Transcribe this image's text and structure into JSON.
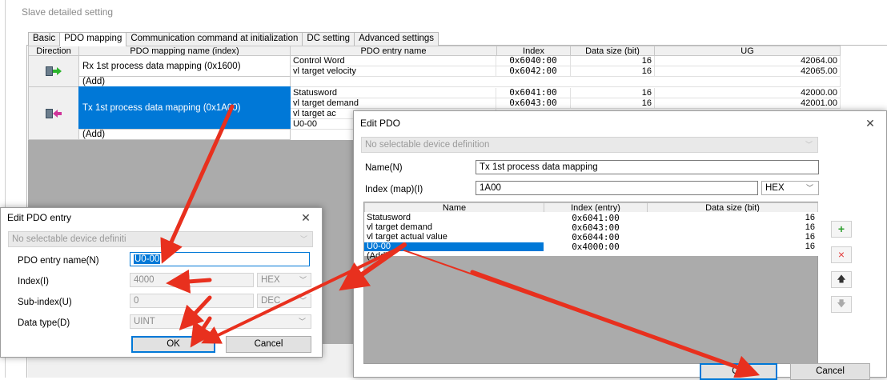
{
  "window": {
    "title": "Slave detailed setting"
  },
  "tabs": [
    "Basic",
    "PDO mapping",
    "Communication command at initialization",
    "DC setting",
    "Advanced settings"
  ],
  "grid": {
    "headers": [
      "Direction",
      "PDO mapping name (index)",
      "PDO entry name",
      "Index",
      "Data size (bit)",
      "UG"
    ],
    "rx": {
      "name": "Rx 1st process data mapping (0x1600)",
      "entries": [
        {
          "name": "Control Word",
          "index": "0x6040:00",
          "size": "16",
          "ug": "42064.00"
        },
        {
          "name": "vl target velocity",
          "index": "0x6042:00",
          "size": "16",
          "ug": "42065.00"
        }
      ],
      "add": "(Add)"
    },
    "tx": {
      "name": "Tx 1st process data mapping (0x1A00)",
      "entries": [
        {
          "name": "Statusword",
          "index": "0x6041:00",
          "size": "16",
          "ug": "42000.00"
        },
        {
          "name": "vl target demand",
          "index": "0x6043:00",
          "size": "16",
          "ug": "42001.00"
        },
        {
          "name": "vl target ac",
          "index": "",
          "size": "",
          "ug": ""
        },
        {
          "name": "U0-00",
          "index": "",
          "size": "",
          "ug": ""
        }
      ],
      "add": "(Add)"
    }
  },
  "edit_pdo_entry": {
    "title": "Edit PDO entry",
    "device_def": "No selectable device definiti",
    "labels": {
      "name": "PDO entry name(N)",
      "index": "Index(I)",
      "subindex": "Sub-index(U)",
      "dtype": "Data type(D)"
    },
    "values": {
      "name": "U0-00",
      "index": "4000",
      "index_fmt": "HEX",
      "subindex": "0",
      "subindex_fmt": "DEC",
      "dtype": "UINT"
    },
    "ok": "OK",
    "cancel": "Cancel"
  },
  "edit_pdo": {
    "title": "Edit PDO",
    "device_def": "No selectable device definition",
    "labels": {
      "name": "Name(N)",
      "index": "Index (map)(I)"
    },
    "values": {
      "name": "Tx 1st process data mapping",
      "index": "1A00",
      "index_fmt": "HEX"
    },
    "headers": [
      "Name",
      "Index (entry)",
      "Data size (bit)"
    ],
    "entries": [
      {
        "name": "Statusword",
        "index": "0x6041:00",
        "size": "16"
      },
      {
        "name": "vl target demand",
        "index": "0x6043:00",
        "size": "16"
      },
      {
        "name": "vl target actual value",
        "index": "0x6044:00",
        "size": "16"
      },
      {
        "name": "U0-00",
        "index": "0x4000:00",
        "size": "16"
      }
    ],
    "add": "(Add)",
    "side_buttons": {
      "add": "+",
      "remove": "×",
      "up": "🡅",
      "down": "🡇"
    },
    "ok": "OK",
    "cancel": "Cancel"
  },
  "colors": {
    "selection": "#0078d7",
    "annotation_arrow": "#e8301e",
    "add_green": "#2e9e2e",
    "remove_red": "#e23b3b"
  },
  "icons": [
    "rx-direction-icon",
    "tx-direction-icon",
    "close-icon",
    "chevron-down-icon",
    "annotation-arrow"
  ]
}
